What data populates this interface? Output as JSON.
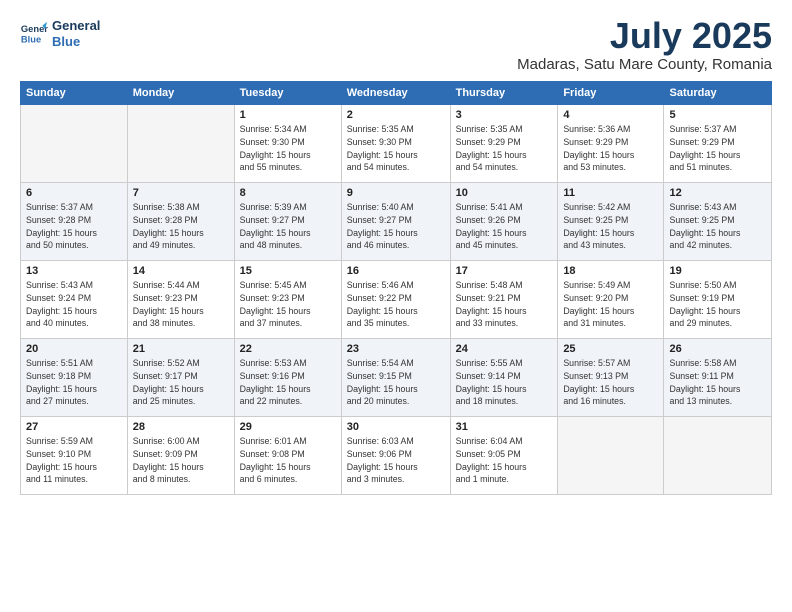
{
  "logo": {
    "line1": "General",
    "line2": "Blue"
  },
  "title": "July 2025",
  "location": "Madaras, Satu Mare County, Romania",
  "weekdays": [
    "Sunday",
    "Monday",
    "Tuesday",
    "Wednesday",
    "Thursday",
    "Friday",
    "Saturday"
  ],
  "weeks": [
    [
      {
        "day": "",
        "info": ""
      },
      {
        "day": "",
        "info": ""
      },
      {
        "day": "1",
        "info": "Sunrise: 5:34 AM\nSunset: 9:30 PM\nDaylight: 15 hours\nand 55 minutes."
      },
      {
        "day": "2",
        "info": "Sunrise: 5:35 AM\nSunset: 9:30 PM\nDaylight: 15 hours\nand 54 minutes."
      },
      {
        "day": "3",
        "info": "Sunrise: 5:35 AM\nSunset: 9:29 PM\nDaylight: 15 hours\nand 54 minutes."
      },
      {
        "day": "4",
        "info": "Sunrise: 5:36 AM\nSunset: 9:29 PM\nDaylight: 15 hours\nand 53 minutes."
      },
      {
        "day": "5",
        "info": "Sunrise: 5:37 AM\nSunset: 9:29 PM\nDaylight: 15 hours\nand 51 minutes."
      }
    ],
    [
      {
        "day": "6",
        "info": "Sunrise: 5:37 AM\nSunset: 9:28 PM\nDaylight: 15 hours\nand 50 minutes."
      },
      {
        "day": "7",
        "info": "Sunrise: 5:38 AM\nSunset: 9:28 PM\nDaylight: 15 hours\nand 49 minutes."
      },
      {
        "day": "8",
        "info": "Sunrise: 5:39 AM\nSunset: 9:27 PM\nDaylight: 15 hours\nand 48 minutes."
      },
      {
        "day": "9",
        "info": "Sunrise: 5:40 AM\nSunset: 9:27 PM\nDaylight: 15 hours\nand 46 minutes."
      },
      {
        "day": "10",
        "info": "Sunrise: 5:41 AM\nSunset: 9:26 PM\nDaylight: 15 hours\nand 45 minutes."
      },
      {
        "day": "11",
        "info": "Sunrise: 5:42 AM\nSunset: 9:25 PM\nDaylight: 15 hours\nand 43 minutes."
      },
      {
        "day": "12",
        "info": "Sunrise: 5:43 AM\nSunset: 9:25 PM\nDaylight: 15 hours\nand 42 minutes."
      }
    ],
    [
      {
        "day": "13",
        "info": "Sunrise: 5:43 AM\nSunset: 9:24 PM\nDaylight: 15 hours\nand 40 minutes."
      },
      {
        "day": "14",
        "info": "Sunrise: 5:44 AM\nSunset: 9:23 PM\nDaylight: 15 hours\nand 38 minutes."
      },
      {
        "day": "15",
        "info": "Sunrise: 5:45 AM\nSunset: 9:23 PM\nDaylight: 15 hours\nand 37 minutes."
      },
      {
        "day": "16",
        "info": "Sunrise: 5:46 AM\nSunset: 9:22 PM\nDaylight: 15 hours\nand 35 minutes."
      },
      {
        "day": "17",
        "info": "Sunrise: 5:48 AM\nSunset: 9:21 PM\nDaylight: 15 hours\nand 33 minutes."
      },
      {
        "day": "18",
        "info": "Sunrise: 5:49 AM\nSunset: 9:20 PM\nDaylight: 15 hours\nand 31 minutes."
      },
      {
        "day": "19",
        "info": "Sunrise: 5:50 AM\nSunset: 9:19 PM\nDaylight: 15 hours\nand 29 minutes."
      }
    ],
    [
      {
        "day": "20",
        "info": "Sunrise: 5:51 AM\nSunset: 9:18 PM\nDaylight: 15 hours\nand 27 minutes."
      },
      {
        "day": "21",
        "info": "Sunrise: 5:52 AM\nSunset: 9:17 PM\nDaylight: 15 hours\nand 25 minutes."
      },
      {
        "day": "22",
        "info": "Sunrise: 5:53 AM\nSunset: 9:16 PM\nDaylight: 15 hours\nand 22 minutes."
      },
      {
        "day": "23",
        "info": "Sunrise: 5:54 AM\nSunset: 9:15 PM\nDaylight: 15 hours\nand 20 minutes."
      },
      {
        "day": "24",
        "info": "Sunrise: 5:55 AM\nSunset: 9:14 PM\nDaylight: 15 hours\nand 18 minutes."
      },
      {
        "day": "25",
        "info": "Sunrise: 5:57 AM\nSunset: 9:13 PM\nDaylight: 15 hours\nand 16 minutes."
      },
      {
        "day": "26",
        "info": "Sunrise: 5:58 AM\nSunset: 9:11 PM\nDaylight: 15 hours\nand 13 minutes."
      }
    ],
    [
      {
        "day": "27",
        "info": "Sunrise: 5:59 AM\nSunset: 9:10 PM\nDaylight: 15 hours\nand 11 minutes."
      },
      {
        "day": "28",
        "info": "Sunrise: 6:00 AM\nSunset: 9:09 PM\nDaylight: 15 hours\nand 8 minutes."
      },
      {
        "day": "29",
        "info": "Sunrise: 6:01 AM\nSunset: 9:08 PM\nDaylight: 15 hours\nand 6 minutes."
      },
      {
        "day": "30",
        "info": "Sunrise: 6:03 AM\nSunset: 9:06 PM\nDaylight: 15 hours\nand 3 minutes."
      },
      {
        "day": "31",
        "info": "Sunrise: 6:04 AM\nSunset: 9:05 PM\nDaylight: 15 hours\nand 1 minute."
      },
      {
        "day": "",
        "info": ""
      },
      {
        "day": "",
        "info": ""
      }
    ]
  ]
}
